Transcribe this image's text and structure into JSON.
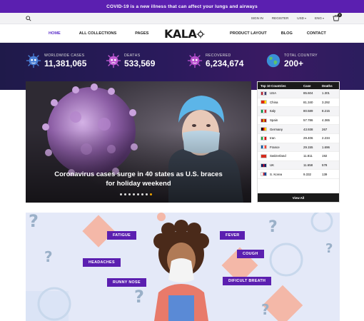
{
  "announcement": "COVID-19 is a new illness that can affect your lungs and airways",
  "topbar": {
    "sign_in": "SIGN IN",
    "register": "REGISTER",
    "currency": "USD",
    "language": "ENG",
    "cart_count": "0"
  },
  "nav": {
    "home": "HOME",
    "all_collections": "ALL COLLECTIONS",
    "pages": "PAGES",
    "logo": "KALA",
    "product_layout": "PRODUCT LAYOUT",
    "blog": "BLOG",
    "contact": "CONTACT"
  },
  "stats": [
    {
      "label": "WORLDWIDE CASES",
      "value": "11,381,065"
    },
    {
      "label": "DEATHS",
      "value": "533,569"
    },
    {
      "label": "RECOVERED",
      "value": "6,234,674"
    },
    {
      "label": "TOTAL COUNTRY",
      "value": "200+"
    }
  ],
  "hero": {
    "title": "Coronavirus cases surge in 40 states as U.S. braces for holiday weekend",
    "slides": 8,
    "active_slide": 7
  },
  "table": {
    "headers": [
      "Top 10 Countries",
      "Case",
      "Deaths"
    ],
    "rows": [
      {
        "country": "USA",
        "case": "85.604",
        "deaths": "1.301",
        "flag": [
          "#b22234",
          "#ffffff",
          "#3c3b6e"
        ]
      },
      {
        "country": "China",
        "case": "81.340",
        "deaths": "3.292",
        "flag": [
          "#de2910",
          "#de2910",
          "#ffde00"
        ]
      },
      {
        "country": "Italy",
        "case": "80.589",
        "deaths": "8.215",
        "flag": [
          "#009246",
          "#ffffff",
          "#ce2b37"
        ]
      },
      {
        "country": "Spain",
        "case": "57.786",
        "deaths": "4.365",
        "flag": [
          "#aa151b",
          "#f1bf00",
          "#aa151b"
        ]
      },
      {
        "country": "Germany",
        "case": "43.938",
        "deaths": "267",
        "flag": [
          "#000000",
          "#dd0000",
          "#ffce00"
        ]
      },
      {
        "country": "Iran",
        "case": "29.406",
        "deaths": "2.234",
        "flag": [
          "#239f40",
          "#ffffff",
          "#da0000"
        ]
      },
      {
        "country": "France",
        "case": "29.155",
        "deaths": "1.696",
        "flag": [
          "#0055a4",
          "#ffffff",
          "#ef4135"
        ]
      },
      {
        "country": "Switzerland",
        "case": "11.811",
        "deaths": "192",
        "flag": [
          "#d52b1e",
          "#d52b1e",
          "#d52b1e"
        ]
      },
      {
        "country": "UK",
        "case": "11.658",
        "deaths": "578",
        "flag": [
          "#012169",
          "#c8102e",
          "#012169"
        ]
      },
      {
        "country": "S. Korea",
        "case": "9.332",
        "deaths": "139",
        "flag": [
          "#ffffff",
          "#cd2e3a",
          "#0047a0"
        ]
      }
    ],
    "footer": "View All"
  },
  "banner": {
    "tags": [
      "FATIGUE",
      "FEVER",
      "COUGH",
      "HEADACHES",
      "RUNNY NOSE",
      "DIFICULT BREATH"
    ]
  },
  "colors": {
    "brand": "#5b1fb0",
    "accent": "#5b2fc9",
    "dot_active": "#f0a500"
  }
}
